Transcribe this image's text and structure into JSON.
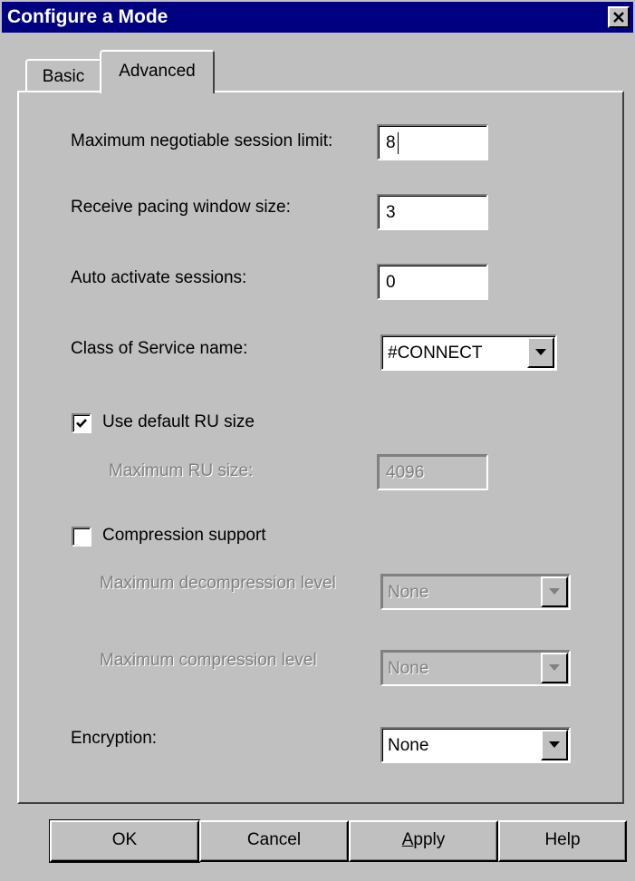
{
  "window": {
    "title": "Configure a Mode"
  },
  "tabs": [
    {
      "label": "Basic"
    },
    {
      "label": "Advanced"
    }
  ],
  "fields": {
    "max_session_limit": {
      "label": "Maximum negotiable session limit:",
      "value": "8"
    },
    "receive_pacing": {
      "label": "Receive pacing window size:",
      "value": "3"
    },
    "auto_activate": {
      "label": "Auto activate sessions:",
      "value": "0"
    },
    "class_of_service": {
      "label": "Class of Service name:",
      "value": "#CONNECT"
    },
    "use_default_ru": {
      "label": "Use default RU size",
      "checked": true
    },
    "max_ru_size": {
      "label": "Maximum RU size:",
      "value": "4096"
    },
    "compression_support": {
      "label": "Compression support",
      "checked": false
    },
    "max_decompression": {
      "label": "Maximum decompression level",
      "value": "None"
    },
    "max_compression": {
      "label": "Maximum compression level",
      "value": "None"
    },
    "encryption": {
      "label": "Encryption:",
      "value": "None"
    }
  },
  "buttons": {
    "ok": "OK",
    "cancel": "Cancel",
    "apply_prefix": "A",
    "apply_rest": "pply",
    "help": "Help"
  }
}
